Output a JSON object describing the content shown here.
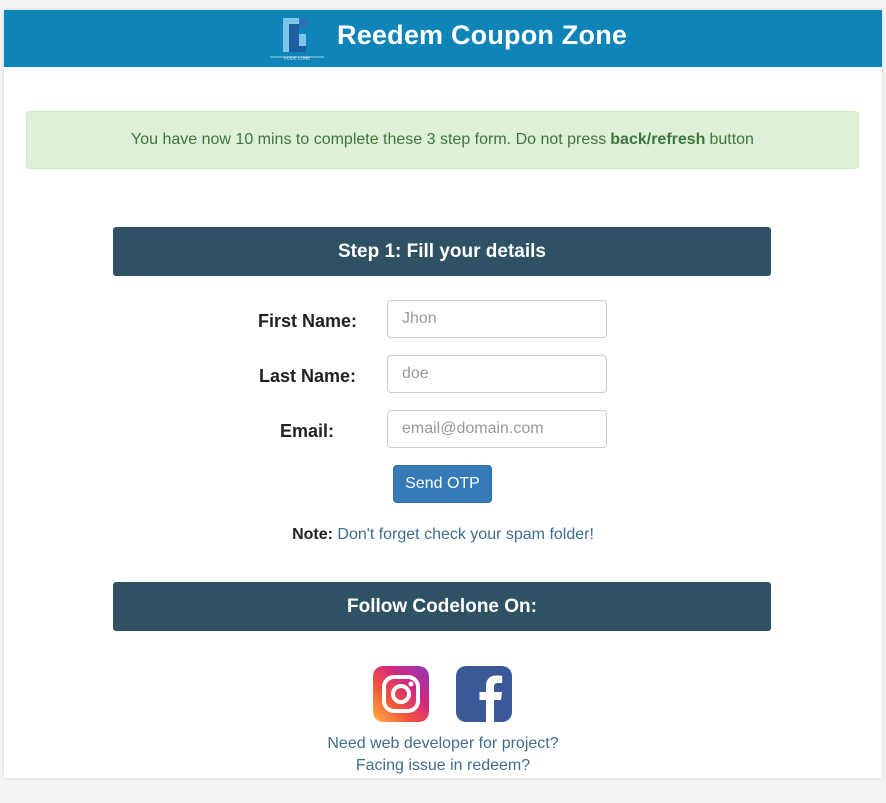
{
  "header": {
    "title": "Reedem Coupon Zone",
    "logo_text": "CODE LONE",
    "background_color": "#0e84b8"
  },
  "alert": {
    "text_before": "You have now 10 mins to complete these 3 step form. Do not press",
    "bold_text": "back/refresh",
    "text_after": "button"
  },
  "step1": {
    "title": "Step 1: Fill your details",
    "fields": {
      "first_name": {
        "label": "First Name:",
        "placeholder": "Jhon"
      },
      "last_name": {
        "label": "Last Name:",
        "placeholder": "doe"
      },
      "email": {
        "label": "Email:",
        "placeholder": "email@domain.com"
      }
    },
    "send_otp_label": "Send OTP",
    "note_label": "Note:",
    "note_text": "Don't forget check your spam folder!"
  },
  "follow": {
    "title": "Follow Codelone On:",
    "icons": [
      "instagram-icon",
      "facebook-icon"
    ]
  },
  "links": {
    "developer": "Need web developer for project?",
    "issue": "Facing issue in redeem?"
  },
  "colors": {
    "section_bar": "#2e5264",
    "button": "#337ab7",
    "link": "#3e6d8e",
    "alert_bg": "#dff0d8"
  }
}
